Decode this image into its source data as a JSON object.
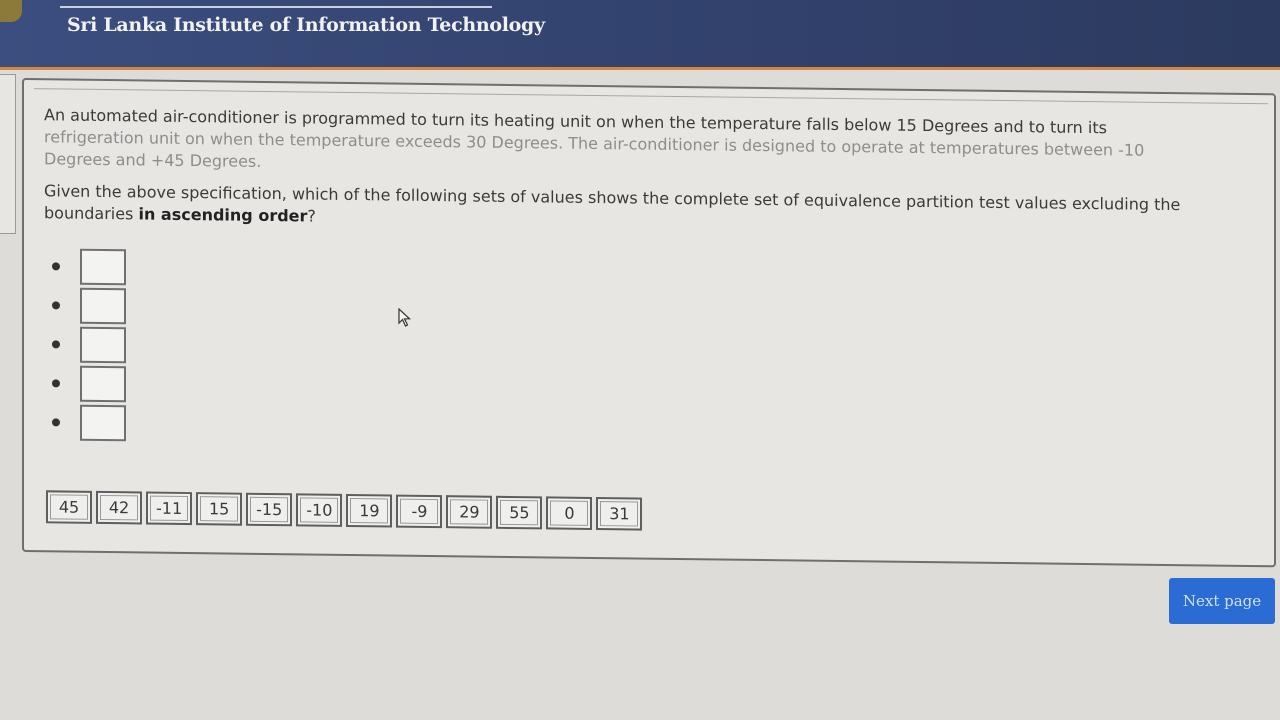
{
  "header": {
    "site_title": "Sri Lanka Institute of Information Technology"
  },
  "question": {
    "line1": "An automated air-conditioner is programmed to turn its heating unit on when the temperature falls below 15 Degrees and to turn its",
    "line2_faded": "refrigeration",
    "line2_rest": " unit on when the temperature exceeds 30 Degrees. The air-conditioner is designed to operate at temperatures between -10",
    "line3": "Degrees and +45 Degrees.",
    "prompt_prefix": "Given the above specification, which of the following sets of values shows the complete set of equivalence partition test values excluding the boundaries ",
    "prompt_bold": "in ascending order",
    "prompt_suffix": "?"
  },
  "answer_slots": [
    {
      "value": ""
    },
    {
      "value": ""
    },
    {
      "value": ""
    },
    {
      "value": ""
    },
    {
      "value": ""
    }
  ],
  "draggable_values": [
    "45",
    "42",
    "-11",
    "15",
    "-15",
    "-10",
    "19",
    "-9",
    "29",
    "55",
    "0",
    "31"
  ],
  "navigation": {
    "next_label": "Next page"
  }
}
